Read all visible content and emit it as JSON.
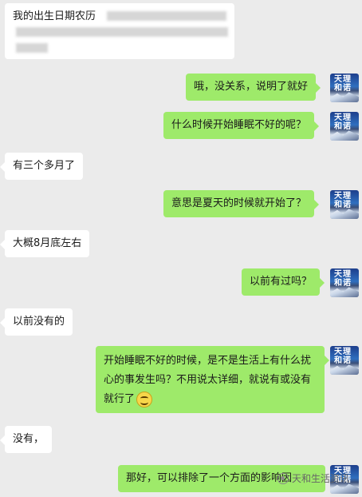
{
  "app": {
    "background": "#ebebeb",
    "bubble_out": "#9eea6a",
    "bubble_in": "#ffffff"
  },
  "avatar": {
    "text_line1": "天理",
    "text_line2": "和诺"
  },
  "messages": [
    {
      "side": "left",
      "text": "我的出生日期农历"
    },
    {
      "side": "right",
      "text": "哦，没关系，说明了就好"
    },
    {
      "side": "right",
      "text": "什么时候开始睡眠不好的呢？"
    },
    {
      "side": "left",
      "text": "有三个多月了"
    },
    {
      "side": "right",
      "text": "意思是夏天的时候就开始了？"
    },
    {
      "side": "left",
      "text": "大概8月底左右"
    },
    {
      "side": "right",
      "text": "以前有过吗？"
    },
    {
      "side": "left",
      "text": "以前没有的"
    },
    {
      "side": "right",
      "text": "开始睡眠不好的时候，是不是生活上有什么扰心的事发生吗？不用说太详细，就说有或没有就行了",
      "emoji": "smile-emoji"
    },
    {
      "side": "left",
      "text": "没有，"
    },
    {
      "side": "right",
      "text": "那好，可以排除了一个方面的影响因"
    }
  ],
  "watermark": {
    "text": "天和生活资讯",
    "icon": "wechat-official-icon"
  }
}
